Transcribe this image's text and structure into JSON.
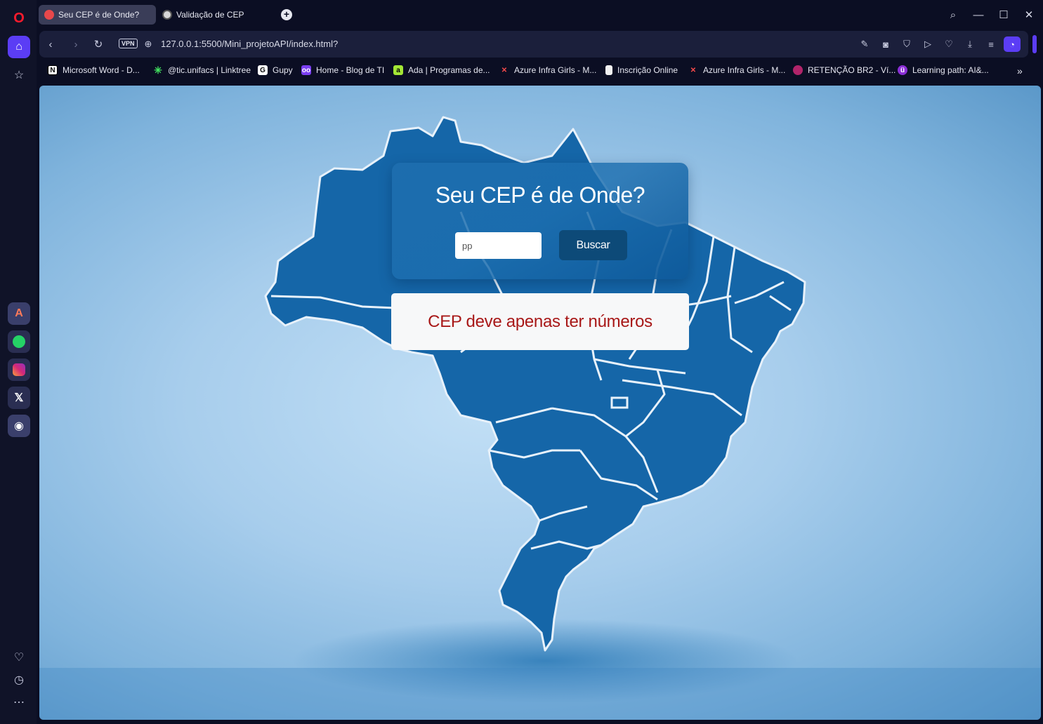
{
  "browser": {
    "tabs": [
      {
        "label": "Seu CEP é de Onde?",
        "active": true
      },
      {
        "label": "Validação de CEP",
        "active": false
      }
    ],
    "new_tab_icon": "plus-icon",
    "address": {
      "vpn_label": "VPN",
      "url": "127.0.0.1:5500/Mini_projetoAPI/index.html?"
    },
    "bookmarks": [
      {
        "label": "Microsoft Word - D...",
        "icon": "N"
      },
      {
        "label": "@tic.unifacs | Linktree",
        "icon": "✳"
      },
      {
        "label": "Gupy",
        "icon": "G"
      },
      {
        "label": "Home - Blog de TI",
        "icon": "oo"
      },
      {
        "label": "Ada | Programas de...",
        "icon": "a"
      },
      {
        "label": "Azure Infra Girls - M...",
        "icon": "✕"
      },
      {
        "label": "Inscrição Online",
        "icon": "▮"
      },
      {
        "label": "Azure Infra Girls - M...",
        "icon": "✕"
      },
      {
        "label": "RETENÇÃO BR2 - Ví...",
        "icon": "●"
      },
      {
        "label": "Learning path: AI&...",
        "icon": "ü"
      }
    ],
    "accent_color": "#5b3df5"
  },
  "page": {
    "title": "Seu CEP é de Onde?",
    "cep_input": {
      "value": "pp",
      "placeholder": ""
    },
    "search_button": "Buscar",
    "message": "CEP deve apenas ter números",
    "message_color": "#a81818",
    "card_color": "#1c6eaf",
    "button_color": "#0d4a78"
  }
}
